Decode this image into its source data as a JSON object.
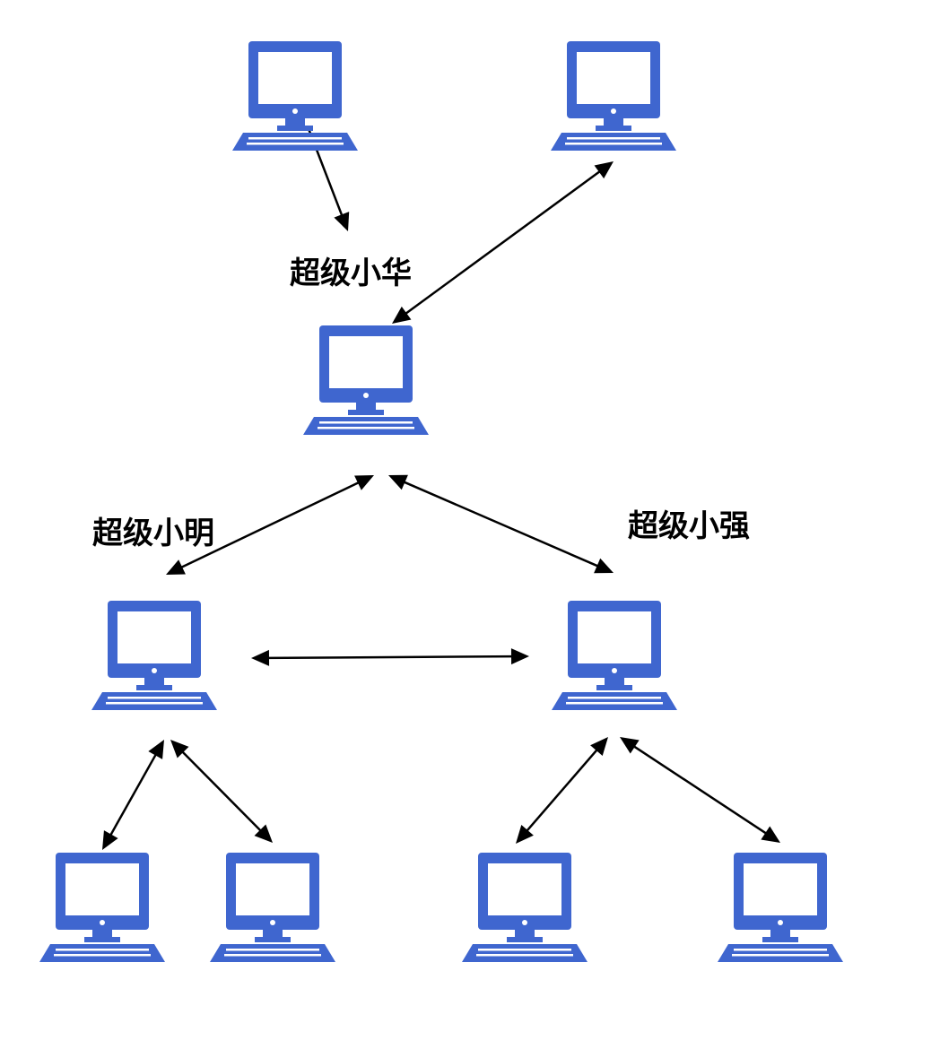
{
  "colors": {
    "computer": "#3F66CF",
    "computer_screen": "#FFFFFF",
    "edge": "#000000",
    "background": "#FFFFFF"
  },
  "icon": "computer-icon",
  "labels": {
    "super_hua": "超级小华",
    "super_ming": "超级小明",
    "super_qiang": "超级小强"
  },
  "nodes": [
    {
      "id": "top-left-peer"
    },
    {
      "id": "top-right-peer"
    },
    {
      "id": "super-hua",
      "label_key": "super_hua"
    },
    {
      "id": "super-ming",
      "label_key": "super_ming"
    },
    {
      "id": "super-qiang",
      "label_key": "super_qiang"
    },
    {
      "id": "ming-leaf-left"
    },
    {
      "id": "ming-leaf-right"
    },
    {
      "id": "qiang-leaf-left"
    },
    {
      "id": "qiang-leaf-right"
    }
  ],
  "edges": [
    {
      "from": "top-left-peer",
      "to": "super-hua",
      "direction": "one-way"
    },
    {
      "from": "super-hua",
      "to": "top-right-peer",
      "direction": "two-way"
    },
    {
      "from": "super-hua",
      "to": "super-ming",
      "direction": "two-way"
    },
    {
      "from": "super-hua",
      "to": "super-qiang",
      "direction": "two-way"
    },
    {
      "from": "super-ming",
      "to": "super-qiang",
      "direction": "two-way"
    },
    {
      "from": "super-ming",
      "to": "ming-leaf-left",
      "direction": "two-way"
    },
    {
      "from": "super-ming",
      "to": "ming-leaf-right",
      "direction": "two-way"
    },
    {
      "from": "super-qiang",
      "to": "qiang-leaf-left",
      "direction": "two-way"
    },
    {
      "from": "super-qiang",
      "to": "qiang-leaf-right",
      "direction": "two-way"
    }
  ]
}
